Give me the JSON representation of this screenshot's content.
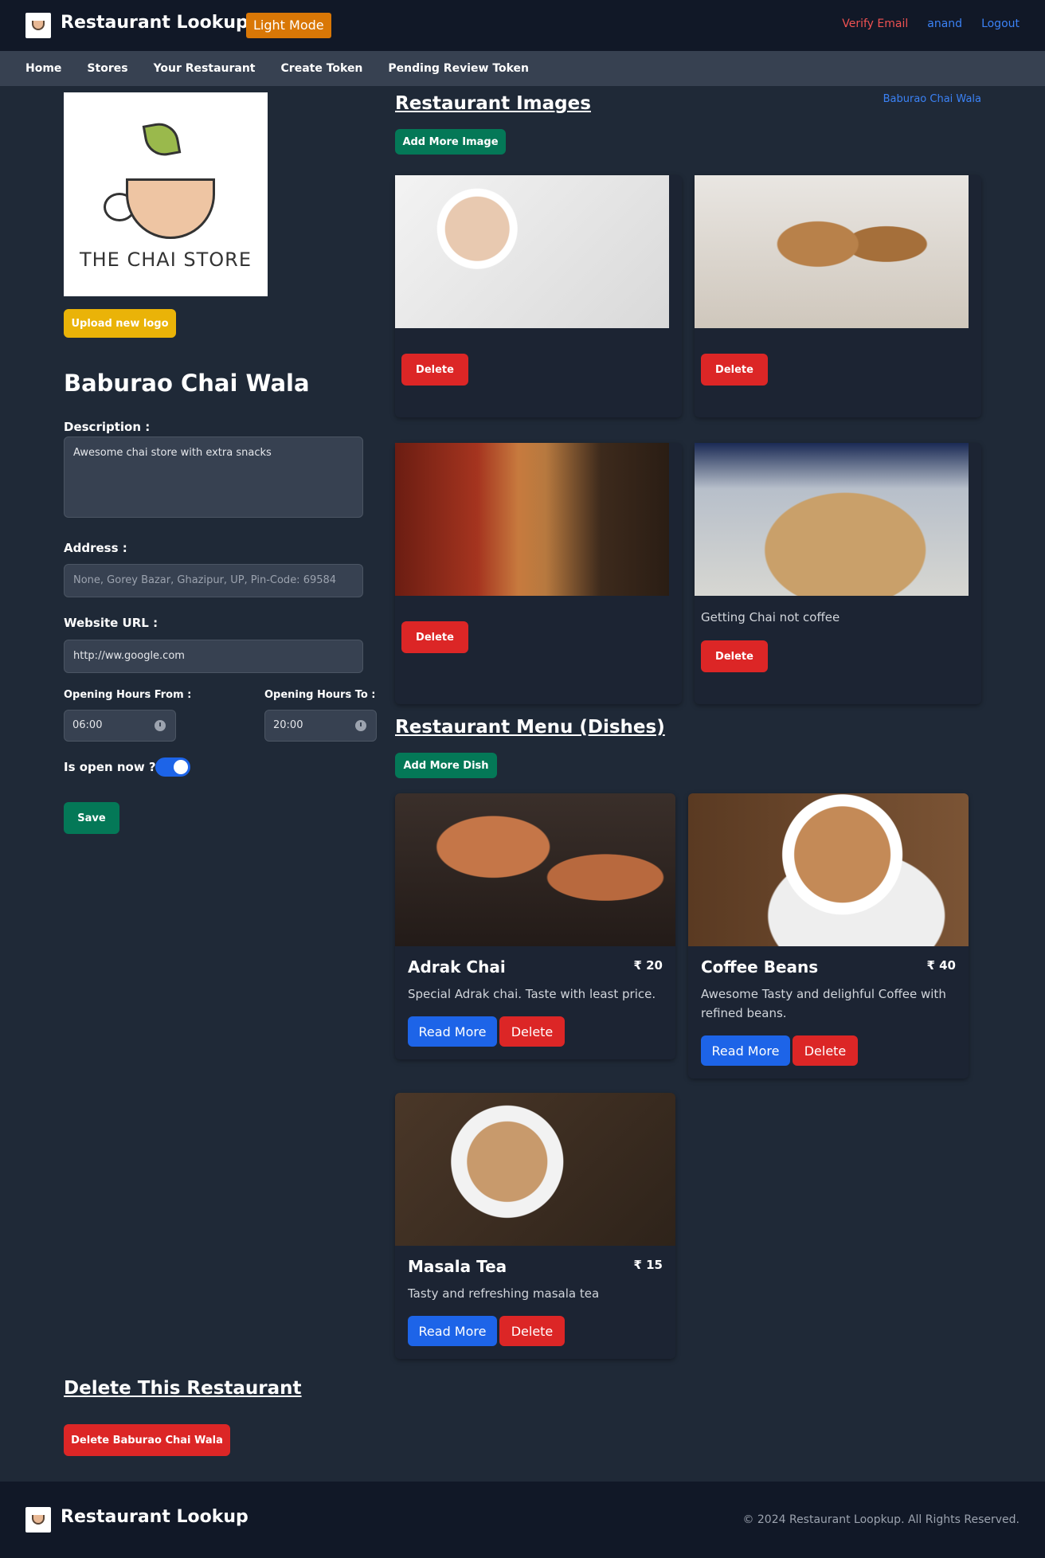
{
  "header": {
    "title": "Restaurant Lookup",
    "mode_button": "Light Mode",
    "verify_email": "Verify Email",
    "user": "anand",
    "logout": "Logout"
  },
  "nav": {
    "items": [
      "Home",
      "Stores",
      "Your Restaurant",
      "Create Token",
      "Pending Review Token"
    ]
  },
  "restaurant": {
    "logo_text": "THE CHAI STORE",
    "upload_logo": "Upload new logo",
    "name": "Baburao Chai Wala",
    "description_label": "Description :",
    "description": "Awesome chai store with extra snacks",
    "address_label": "Address :",
    "address_placeholder": "None, Gorey Bazar, Ghazipur, UP, Pin-Code: 69584",
    "website_label": "Website URL :",
    "website": "http://ww.google.com",
    "hours_from_label": "Opening Hours From :",
    "hours_from": "06:00",
    "hours_to_label": "Opening Hours To :",
    "hours_to": "20:00",
    "open_now_label": "Is open now ?",
    "open_now": true,
    "save": "Save"
  },
  "images_section": {
    "title": "Restaurant Images",
    "restaurant_link": "Baburao Chai Wala",
    "add_button": "Add More Image",
    "delete_label": "Delete",
    "images": [
      {
        "caption": ""
      },
      {
        "caption": ""
      },
      {
        "caption": ""
      },
      {
        "caption": "Getting Chai not coffee"
      }
    ]
  },
  "menu_section": {
    "title": "Restaurant Menu (Dishes)",
    "add_button": "Add More Dish",
    "read_more": "Read More",
    "delete": "Delete",
    "dishes": [
      {
        "name": "Adrak Chai",
        "price": "₹ 20",
        "description": "Special Adrak chai. Taste with least price."
      },
      {
        "name": "Coffee Beans",
        "price": "₹ 40",
        "description": "Awesome Tasty and delighful Coffee with refined beans."
      },
      {
        "name": "Masala Tea",
        "price": "₹ 15",
        "description": "Tasty and refreshing masala tea"
      }
    ]
  },
  "danger": {
    "title": "Delete This Restaurant",
    "button": "Delete Baburao Chai Wala"
  },
  "footer": {
    "title": "Restaurant Lookup",
    "copyright": "© 2024 Restaurant Loopkup. All Rights Reserved."
  }
}
